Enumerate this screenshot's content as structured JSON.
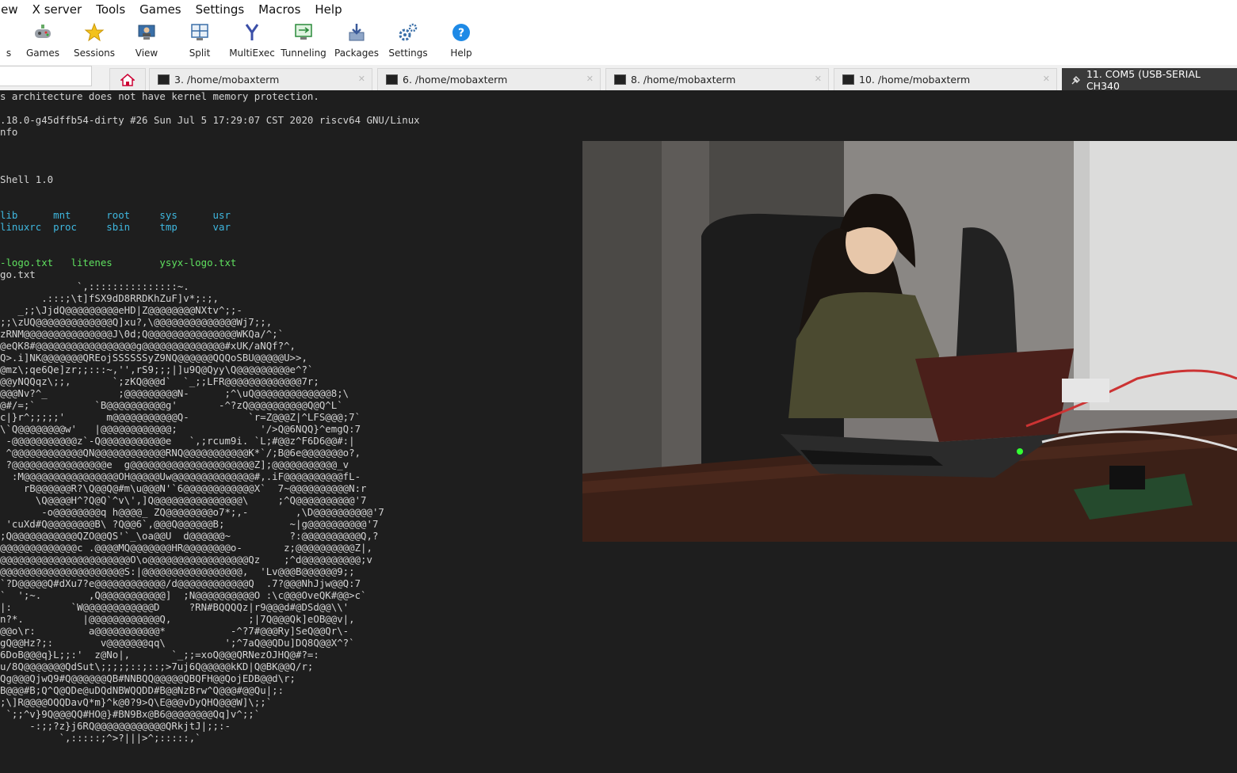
{
  "menubar": {
    "items": [
      "iew",
      "X server",
      "Tools",
      "Games",
      "Settings",
      "Macros",
      "Help"
    ]
  },
  "toolbar": {
    "items": [
      {
        "label": "s",
        "icon": "partial-icon"
      },
      {
        "label": "Games",
        "icon": "gamepad-icon"
      },
      {
        "label": "Sessions",
        "icon": "star-icon"
      },
      {
        "label": "View",
        "icon": "view-icon"
      },
      {
        "label": "Split",
        "icon": "split-icon"
      },
      {
        "label": "MultiExec",
        "icon": "multiexec-icon"
      },
      {
        "label": "Tunneling",
        "icon": "tunneling-icon"
      },
      {
        "label": "Packages",
        "icon": "packages-icon"
      },
      {
        "label": "Settings",
        "icon": "gears-icon"
      },
      {
        "label": "Help",
        "icon": "help-icon"
      }
    ]
  },
  "tabs": [
    {
      "label": "3. /home/mobaxterm"
    },
    {
      "label": "6. /home/mobaxterm"
    },
    {
      "label": "8. /home/mobaxterm"
    },
    {
      "label": "10. /home/mobaxterm"
    },
    {
      "label": "11. COM5  (USB-SERIAL CH340"
    }
  ],
  "terminal": {
    "lines": [
      {
        "t": "s architecture does not have kernel memory protection.",
        "c": ""
      },
      {
        "t": "",
        "c": ""
      },
      {
        "t": ".18.0-g45dffb54-dirty #26 Sun Jul 5 17:29:07 CST 2020 riscv64 GNU/Linux",
        "c": ""
      },
      {
        "t": "nfo",
        "c": ""
      },
      {
        "t": "",
        "c": ""
      },
      {
        "t": "",
        "c": ""
      },
      {
        "t": "",
        "c": ""
      },
      {
        "t": "Shell 1.0",
        "c": ""
      },
      {
        "t": "",
        "c": ""
      },
      {
        "t": "",
        "c": ""
      },
      {
        "t": "lib      mnt      root     sys      usr",
        "c": "cyan"
      },
      {
        "t": "linuxrc  proc     sbin     tmp      var",
        "c": "cyan"
      },
      {
        "t": "",
        "c": ""
      },
      {
        "t": "",
        "c": ""
      },
      {
        "t": "-logo.txt   litenes        ysyx-logo.txt",
        "c": "green"
      },
      {
        "t": "go.txt",
        "c": ""
      },
      {
        "t": "             `,:::::::::::::::~.",
        "c": ""
      },
      {
        "t": "       .:::;\\t]fSX9dD8RRDKhZuF]v*;:;,",
        "c": ""
      },
      {
        "t": "   _;;\\JjdQ@@@@@@@@@eHD|Z@@@@@@@@NXtv^;;-",
        "c": ""
      },
      {
        "t": ";;\\zUQ@@@@@@@@@@@@@Q]xu?,\\@@@@@@@@@@@@@@Wj7;;,",
        "c": ""
      },
      {
        "t": "zRNM@@@@@@@@@@@@@@@J\\0d;Q@@@@@@@@@@@@@@@WKQa/^;`",
        "c": ""
      },
      {
        "t": "@eQK8#@@@@@@@@@@@@@@@@@g@@@@@@@@@@@@@@#xUK/aNQf?^,",
        "c": ""
      },
      {
        "t": "Q>.i]NK@@@@@@@QREojSSSSSSyZ9NQ@@@@@@QQQoSBU@@@@@U>>,",
        "c": ""
      },
      {
        "t": "@mz\\;qe6Qe]zr;;:::~,'',rS9;;;|]u9Q@Qyy\\Q@@@@@@@@@e^?`",
        "c": ""
      },
      {
        "t": "@@yNQQqz\\;;,       `;zKQ@@@d`  `_;;LFR@@@@@@@@@@@@@7r;",
        "c": ""
      },
      {
        "t": "@@@Nv?^_            ;@@@@@@@@@N-      ;^\\uQ@@@@@@@@@@@@@8;\\",
        "c": ""
      },
      {
        "t": "@#/=;`          `B@@@@@@@@@@g'       -^?zQ@@@@@@@@@@Q@Q^L`",
        "c": ""
      },
      {
        "t": "c|}r^;;;;;'       m@@@@@@@@@@@Q-          `r=Z@@@Z|^LFS@@@;7`",
        "c": ""
      },
      {
        "t": "\\`Q@@@@@@@@w'   |@@@@@@@@@@@@;              '/>Q@6NQQ}^emgQ:7",
        "c": ""
      },
      {
        "t": " -@@@@@@@@@@@z`-Q@@@@@@@@@@@e   `,;rcum9i. `L;#@@z^F6D6@@#:|",
        "c": ""
      },
      {
        "t": " ^@@@@@@@@@@@@QN@@@@@@@@@@@@RNQ@@@@@@@@@@@K*`/;B@6e@@@@@@@o?,",
        "c": ""
      },
      {
        "t": " ?@@@@@@@@@@@@@@@@e  g@@@@@@@@@@@@@@@@@@@@@Z];@@@@@@@@@@@_v",
        "c": ""
      },
      {
        "t": "  :M@@@@@@@@@@@@@@@@OH@@@@@Uw@@@@@@@@@@@@@@#,.iF@@@@@@@@@@fL-",
        "c": ""
      },
      {
        "t": "    rB@@@@@@R?\\Q@@Q@#m\\u@@@N'`6@@@@@@@@@@@@X`  7~@@@@@@@@@@N:r",
        "c": ""
      },
      {
        "t": "      \\Q@@@@H^?Q@Q`^v\\',]Q@@@@@@@@@@@@@@@\\     ;^Q@@@@@@@@@@'7",
        "c": ""
      },
      {
        "t": "       -o@@@@@@@@q h@@@@_ ZQ@@@@@@@@o7*;,-        ,\\D@@@@@@@@@@'7",
        "c": ""
      },
      {
        "t": " 'cuXd#Q@@@@@@@@B\\ ?Q@@6`,@@@Q@@@@@@B;           ~|g@@@@@@@@@@'7",
        "c": ""
      },
      {
        "t": ";Q@@@@@@@@@@@QZO@@QS'`_\\oa@@U  d@@@@@@~          ?:@@@@@@@@@@Q,?",
        "c": ""
      },
      {
        "t": "@@@@@@@@@@@@@c .@@@@MQ@@@@@@@HR@@@@@@@@o-       z;@@@@@@@@@@Z|,",
        "c": ""
      },
      {
        "t": "@@@@@@@@@@@@@@@@@@@@@@O\\o@@@@@@@@@@@@@@@@@Qz    ;^d@@@@@@@@@@;v",
        "c": ""
      },
      {
        "t": "@@@@@@@@@@@@@@@@@@@@@S:|@@@@@@@@@@@@@@@@@,  'Lv@@@B@@@@@@9;;",
        "c": ""
      },
      {
        "t": "`?D@@@@@Q#dXu7?e@@@@@@@@@@@@/d@@@@@@@@@@@@Q  .7?@@@NhJjw@@Q:7",
        "c": ""
      },
      {
        "t": "`  ';~.        ,Q@@@@@@@@@@@]  ;N@@@@@@@@@@O :\\c@@@OveQK#@@>c`",
        "c": ""
      },
      {
        "t": "|:          `W@@@@@@@@@@@@D     ?RN#BQQQQz|r9@@@d#@DSd@@\\\\'",
        "c": ""
      },
      {
        "t": "n?*.          |@@@@@@@@@@@@Q,             ;|7Q@@@Qk]eOB@@v|,",
        "c": ""
      },
      {
        "t": "@@o\\r:         a@@@@@@@@@@@*           -^?7#@@@Ry]SeQ@@Qr\\-",
        "c": ""
      },
      {
        "t": "gQ@@Hz?;:        v@@@@@@@qq\\          ';^7aQ@@QDu]DQ8Q@@X^?`",
        "c": ""
      },
      {
        "t": "6DoB@@@q}L;;:'  z@No|,       `_;;=xoQ@@@QRNezOJHQ@#?=:",
        "c": ""
      },
      {
        "t": "u/8Q@@@@@@@QdSut\\;;;;;::;::;>7uj6Q@@@@@kKD|Q@BK@@Q/r;",
        "c": ""
      },
      {
        "t": "Qg@@@QjwQ9#Q@@@@@@QB#NNBQQ@@@@@QBQFH@@QojEDB@@d\\r;",
        "c": ""
      },
      {
        "t": "B@@@#B;Q^Q@QDe@uDQdNBWQQDD#B@@NzBrw^Q@@@#@@Qu|;:",
        "c": ""
      },
      {
        "t": ";\\]R@@@@OQQDavQ*m}^k@0?9>Q\\E@@@vDyQHQ@@@W]\\;;`",
        "c": ""
      },
      {
        "t": " `;;^v}9Q@@@QQ#HO@}#BN9Bx@B6@@@@@@@@Qq]v^;;`",
        "c": ""
      },
      {
        "t": "     -:;;?z}j6RQ@@@@@@@@@@@@QRkjtJ|;;:-",
        "c": ""
      },
      {
        "t": "          `,:::::;^>?|||>^;:::::,`",
        "c": ""
      }
    ]
  },
  "colors": {
    "terminal_bg": "#1e1e1e",
    "terminal_fg": "#d4d4d4",
    "dir_color": "#3fb8e0",
    "exec_color": "#5fe05f",
    "active_tab": "#3a3a3a"
  }
}
